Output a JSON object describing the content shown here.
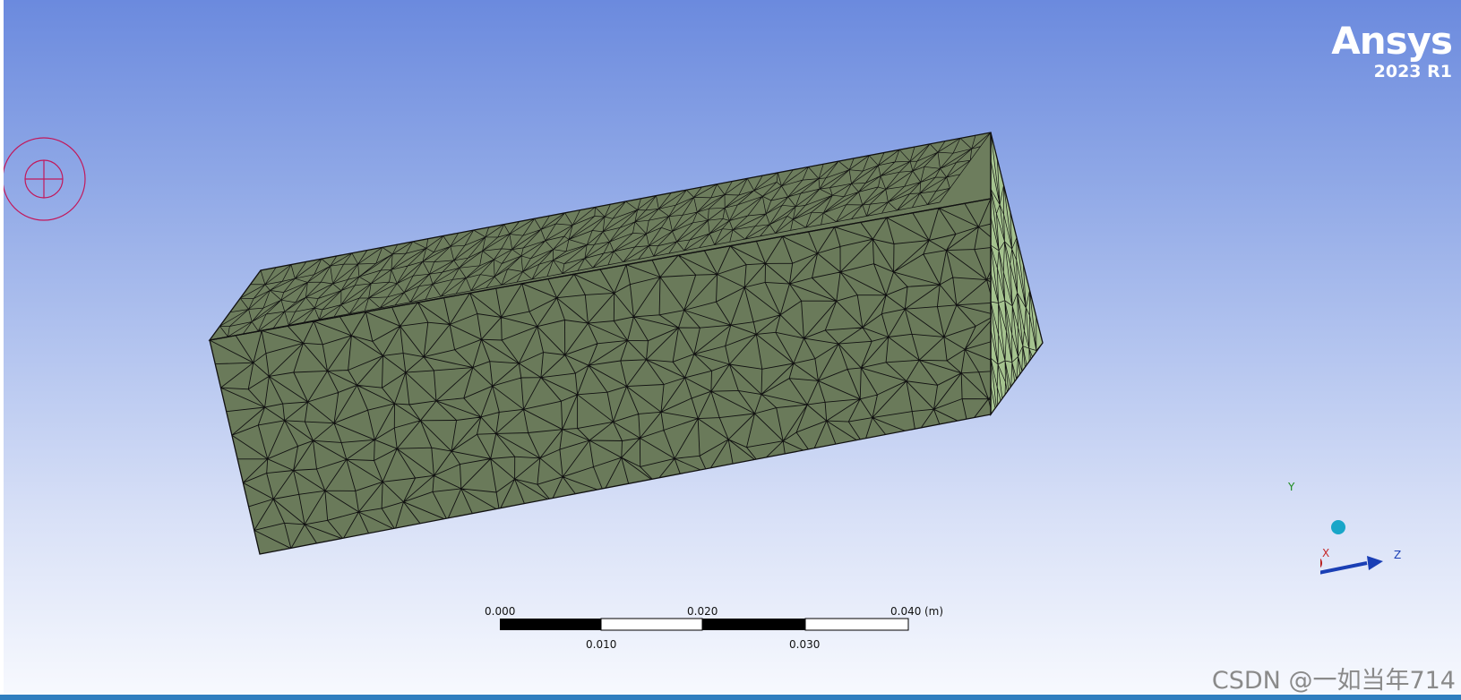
{
  "logo": {
    "name": "Ansys",
    "version": "2023 R1"
  },
  "scale_bar": {
    "unit": "(m)",
    "top_labels": [
      "0.000",
      "0.020",
      "0.040"
    ],
    "bottom_labels": [
      "0.010",
      "0.030"
    ]
  },
  "triad": {
    "x_label": "X",
    "y_label": "Y",
    "z_label": "Z"
  },
  "watermark": "CSDN @一如当年714",
  "colors": {
    "mesh_front": "#6a7a5a",
    "mesh_top": "#6d7d5d",
    "mesh_end": "#a5c38f",
    "mesh_line": "#111111",
    "rotation_cursor": "#c2185b",
    "axis_x": "#c62828",
    "axis_y": "#1b8a1b",
    "axis_z": "#1a3fb5"
  },
  "icons": {
    "rotation_cursor": "rotate-center-icon"
  }
}
